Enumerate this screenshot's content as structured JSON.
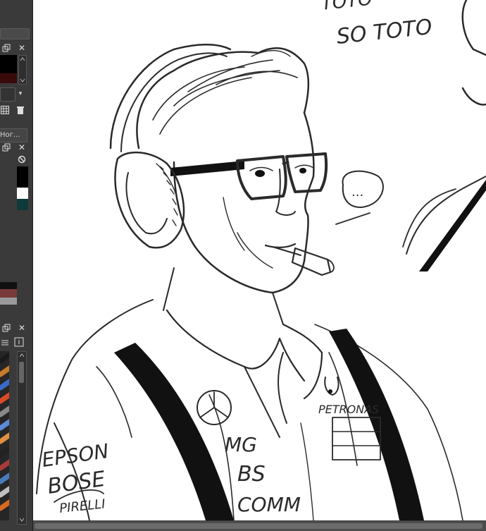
{
  "docker": {
    "float_icon": "float-window-icon",
    "close_glyph": "✕",
    "close_icon": "close-icon",
    "panel_tab_label": "Ног...",
    "grid_icon": "grid-icon",
    "trash_icon": "trash-icon",
    "no_icon": "prohibit-icon",
    "colors": {
      "fg": "#000000",
      "bg_dark_red": "#3a0a0a",
      "history_1": "#000000",
      "history_2": "#ffffff",
      "history_3": "#0e3a3a",
      "strip_1": "#111111",
      "strip_2": "#7a3a3a",
      "strip_3": "#9a9a9a"
    },
    "brushes": [
      "#1a1a1a",
      "#c97a2a",
      "#3a6ac9",
      "#d94a2a",
      "#888888",
      "#5a8ad9",
      "#e09040",
      "#222222",
      "#aa3a3a",
      "#4a7ab9",
      "#c0c0c0",
      "#d86a20"
    ]
  },
  "canvas": {
    "background": "#ffffff",
    "ink": "#2a2a2a",
    "text_top": "ТОТО",
    "text_sototo": "SO TOTO",
    "speech_bubble": "...",
    "patch_epson": "EPSON",
    "patch_bose": "BOSE",
    "patch_pirelli": "PIRELLI",
    "patch_petronas": "PETRONAS",
    "patch_amg": "MG",
    "patch_bs": "BS",
    "patch_comm": "COMM"
  }
}
